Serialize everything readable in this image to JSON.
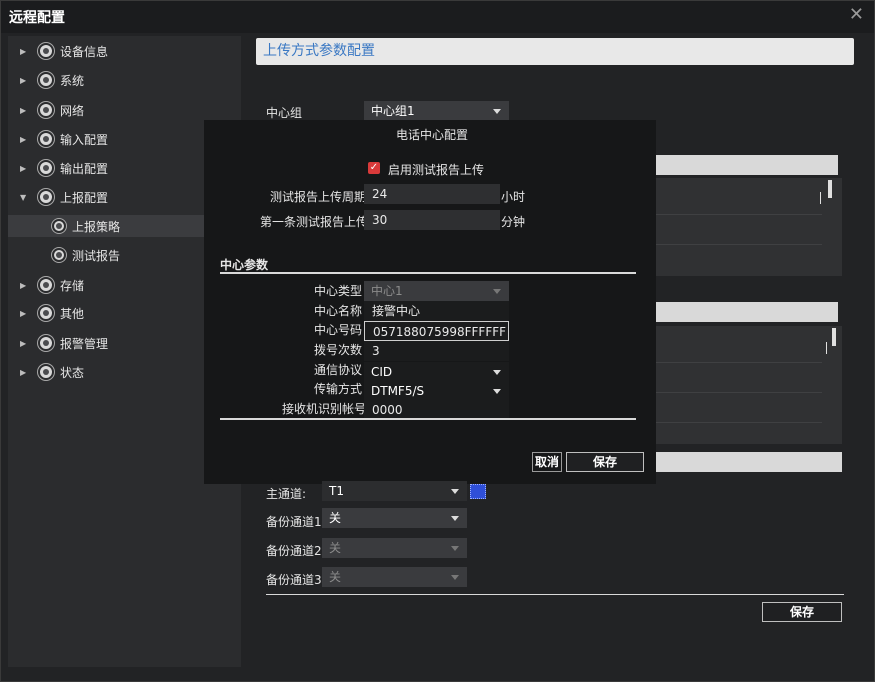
{
  "window": {
    "title": "远程配置",
    "close_icon": "close-icon"
  },
  "sidebar": {
    "items": [
      {
        "label": "设备信息",
        "expanded": false
      },
      {
        "label": "系统",
        "expanded": false
      },
      {
        "label": "网络",
        "expanded": false
      },
      {
        "label": "输入配置",
        "expanded": false
      },
      {
        "label": "输出配置",
        "expanded": false
      },
      {
        "label": "上报配置",
        "expanded": true
      },
      {
        "label": "上报策略",
        "sub": true,
        "selected": true
      },
      {
        "label": "测试报告",
        "sub": true
      },
      {
        "label": "存储",
        "expanded": false
      },
      {
        "label": "其他",
        "expanded": false
      },
      {
        "label": "报警管理",
        "expanded": false
      },
      {
        "label": "状态",
        "expanded": false
      }
    ]
  },
  "main": {
    "section_title": "上传方式参数配置",
    "center_group_label": "中心组",
    "center_group_value": "中心组1",
    "main_channel_label": "主通道:",
    "main_channel_value": "T1",
    "backup1_label": "备份通道1",
    "backup1_value": "关",
    "backup2_label": "备份通道2",
    "backup2_value": "关",
    "backup3_label": "备份通道3",
    "backup3_value": "关",
    "save_label": "保存"
  },
  "dialog": {
    "title": "电话中心配置",
    "enable_test_label": "启用测试报告上传",
    "enable_test_checked": true,
    "period_label": "测试报告上传周期",
    "period_value": "24",
    "period_unit": "小时",
    "first_label": "第一条测试报告上传",
    "first_value": "30",
    "first_unit": "分钟",
    "params_heading": "中心参数",
    "center_type_label": "中心类型",
    "center_type_value": "中心1",
    "center_name_label": "中心名称",
    "center_name_value": "接警中心",
    "center_number_label": "中心号码",
    "center_number_value": "057188075998FFFFFF",
    "dial_times_label": "拨号次数",
    "dial_times_value": "3",
    "protocol_label": "通信协议",
    "protocol_value": "CID",
    "transport_label": "传输方式",
    "transport_value": "DTMF5/S",
    "receiver_label": "接收机识别帐号",
    "receiver_value": "0000",
    "cancel_label": "取消",
    "save_label": "保存"
  },
  "colors": {
    "accent": "#3a78c3",
    "checkbox": "#d93a3a"
  }
}
